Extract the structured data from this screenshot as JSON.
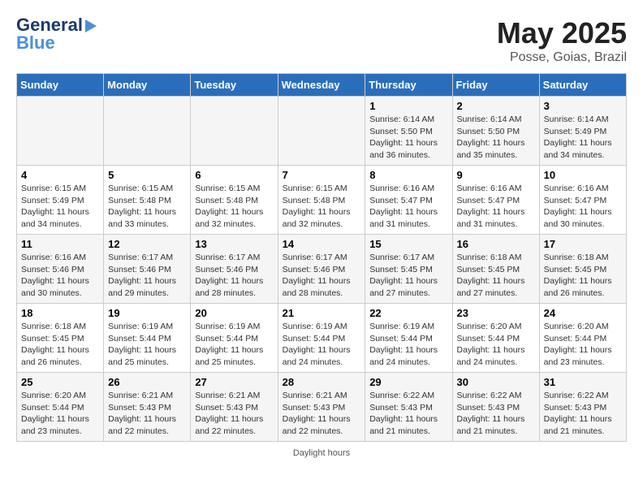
{
  "header": {
    "logo_line1": "General",
    "logo_line2": "Blue",
    "title": "May 2025",
    "location": "Posse, Goias, Brazil"
  },
  "days_of_week": [
    "Sunday",
    "Monday",
    "Tuesday",
    "Wednesday",
    "Thursday",
    "Friday",
    "Saturday"
  ],
  "weeks": [
    [
      {
        "num": "",
        "detail": ""
      },
      {
        "num": "",
        "detail": ""
      },
      {
        "num": "",
        "detail": ""
      },
      {
        "num": "",
        "detail": ""
      },
      {
        "num": "1",
        "detail": "Sunrise: 6:14 AM\nSunset: 5:50 PM\nDaylight: 11 hours\nand 36 minutes."
      },
      {
        "num": "2",
        "detail": "Sunrise: 6:14 AM\nSunset: 5:50 PM\nDaylight: 11 hours\nand 35 minutes."
      },
      {
        "num": "3",
        "detail": "Sunrise: 6:14 AM\nSunset: 5:49 PM\nDaylight: 11 hours\nand 34 minutes."
      }
    ],
    [
      {
        "num": "4",
        "detail": "Sunrise: 6:15 AM\nSunset: 5:49 PM\nDaylight: 11 hours\nand 34 minutes."
      },
      {
        "num": "5",
        "detail": "Sunrise: 6:15 AM\nSunset: 5:48 PM\nDaylight: 11 hours\nand 33 minutes."
      },
      {
        "num": "6",
        "detail": "Sunrise: 6:15 AM\nSunset: 5:48 PM\nDaylight: 11 hours\nand 32 minutes."
      },
      {
        "num": "7",
        "detail": "Sunrise: 6:15 AM\nSunset: 5:48 PM\nDaylight: 11 hours\nand 32 minutes."
      },
      {
        "num": "8",
        "detail": "Sunrise: 6:16 AM\nSunset: 5:47 PM\nDaylight: 11 hours\nand 31 minutes."
      },
      {
        "num": "9",
        "detail": "Sunrise: 6:16 AM\nSunset: 5:47 PM\nDaylight: 11 hours\nand 31 minutes."
      },
      {
        "num": "10",
        "detail": "Sunrise: 6:16 AM\nSunset: 5:47 PM\nDaylight: 11 hours\nand 30 minutes."
      }
    ],
    [
      {
        "num": "11",
        "detail": "Sunrise: 6:16 AM\nSunset: 5:46 PM\nDaylight: 11 hours\nand 30 minutes."
      },
      {
        "num": "12",
        "detail": "Sunrise: 6:17 AM\nSunset: 5:46 PM\nDaylight: 11 hours\nand 29 minutes."
      },
      {
        "num": "13",
        "detail": "Sunrise: 6:17 AM\nSunset: 5:46 PM\nDaylight: 11 hours\nand 28 minutes."
      },
      {
        "num": "14",
        "detail": "Sunrise: 6:17 AM\nSunset: 5:46 PM\nDaylight: 11 hours\nand 28 minutes."
      },
      {
        "num": "15",
        "detail": "Sunrise: 6:17 AM\nSunset: 5:45 PM\nDaylight: 11 hours\nand 27 minutes."
      },
      {
        "num": "16",
        "detail": "Sunrise: 6:18 AM\nSunset: 5:45 PM\nDaylight: 11 hours\nand 27 minutes."
      },
      {
        "num": "17",
        "detail": "Sunrise: 6:18 AM\nSunset: 5:45 PM\nDaylight: 11 hours\nand 26 minutes."
      }
    ],
    [
      {
        "num": "18",
        "detail": "Sunrise: 6:18 AM\nSunset: 5:45 PM\nDaylight: 11 hours\nand 26 minutes."
      },
      {
        "num": "19",
        "detail": "Sunrise: 6:19 AM\nSunset: 5:44 PM\nDaylight: 11 hours\nand 25 minutes."
      },
      {
        "num": "20",
        "detail": "Sunrise: 6:19 AM\nSunset: 5:44 PM\nDaylight: 11 hours\nand 25 minutes."
      },
      {
        "num": "21",
        "detail": "Sunrise: 6:19 AM\nSunset: 5:44 PM\nDaylight: 11 hours\nand 24 minutes."
      },
      {
        "num": "22",
        "detail": "Sunrise: 6:19 AM\nSunset: 5:44 PM\nDaylight: 11 hours\nand 24 minutes."
      },
      {
        "num": "23",
        "detail": "Sunrise: 6:20 AM\nSunset: 5:44 PM\nDaylight: 11 hours\nand 24 minutes."
      },
      {
        "num": "24",
        "detail": "Sunrise: 6:20 AM\nSunset: 5:44 PM\nDaylight: 11 hours\nand 23 minutes."
      }
    ],
    [
      {
        "num": "25",
        "detail": "Sunrise: 6:20 AM\nSunset: 5:44 PM\nDaylight: 11 hours\nand 23 minutes."
      },
      {
        "num": "26",
        "detail": "Sunrise: 6:21 AM\nSunset: 5:43 PM\nDaylight: 11 hours\nand 22 minutes."
      },
      {
        "num": "27",
        "detail": "Sunrise: 6:21 AM\nSunset: 5:43 PM\nDaylight: 11 hours\nand 22 minutes."
      },
      {
        "num": "28",
        "detail": "Sunrise: 6:21 AM\nSunset: 5:43 PM\nDaylight: 11 hours\nand 22 minutes."
      },
      {
        "num": "29",
        "detail": "Sunrise: 6:22 AM\nSunset: 5:43 PM\nDaylight: 11 hours\nand 21 minutes."
      },
      {
        "num": "30",
        "detail": "Sunrise: 6:22 AM\nSunset: 5:43 PM\nDaylight: 11 hours\nand 21 minutes."
      },
      {
        "num": "31",
        "detail": "Sunrise: 6:22 AM\nSunset: 5:43 PM\nDaylight: 11 hours\nand 21 minutes."
      }
    ]
  ],
  "footer": "Daylight hours"
}
